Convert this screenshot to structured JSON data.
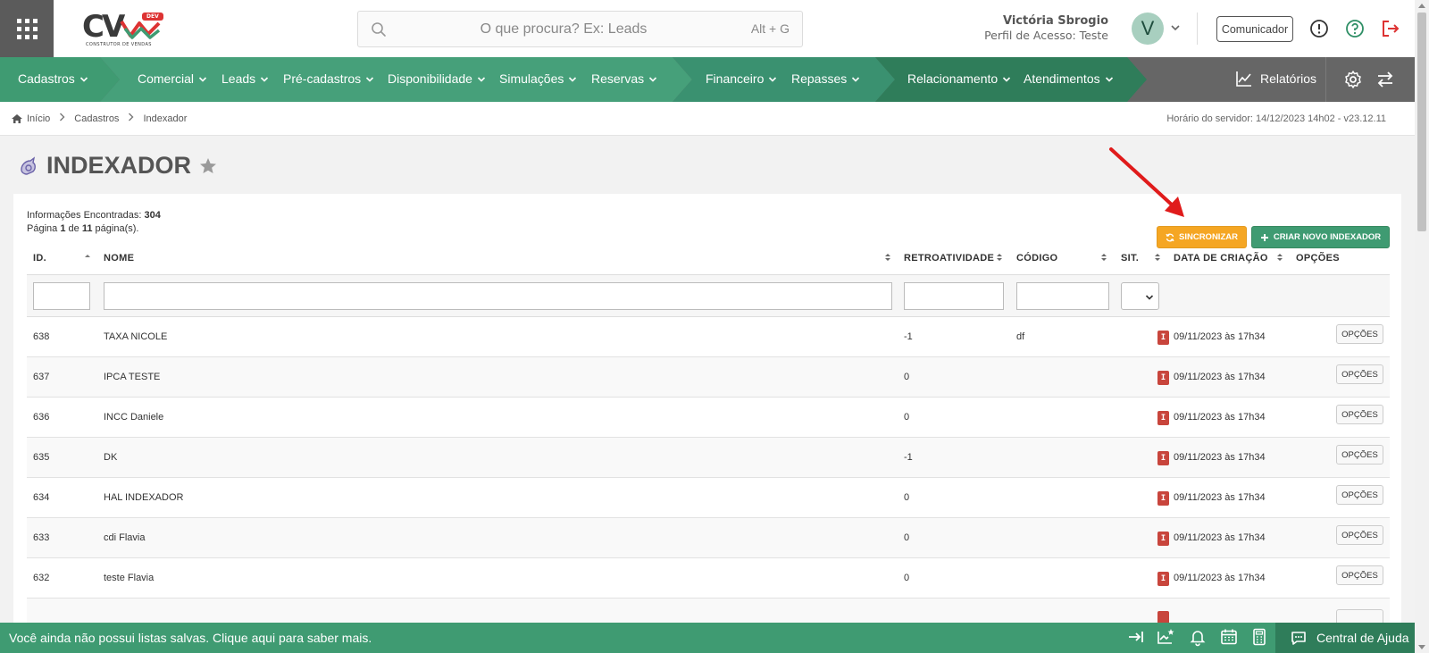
{
  "header": {
    "logo": {
      "text": "CV",
      "badge": "DEV",
      "subtitle": "CONSTRUTOR DE VENDAS"
    },
    "search": {
      "placeholder": "O que procura? Ex: Leads",
      "shortcut": "Alt + G"
    },
    "user": {
      "name": "Victória Sbrogio",
      "profile": "Perfil de Acesso: Teste",
      "initial": "V"
    },
    "communicator_label": "Comunicador"
  },
  "nav": {
    "items": [
      {
        "label": "Cadastros"
      },
      {
        "label": "Comercial"
      },
      {
        "label": "Leads"
      },
      {
        "label": "Pré-cadastros"
      },
      {
        "label": "Disponibilidade"
      },
      {
        "label": "Simulações"
      },
      {
        "label": "Reservas"
      },
      {
        "label": "Financeiro"
      },
      {
        "label": "Repasses"
      },
      {
        "label": "Relacionamento"
      },
      {
        "label": "Atendimentos"
      }
    ],
    "reports_label": "Relatórios",
    "colors": {
      "seg1": "#3f9b72",
      "seg2": "#46a07a",
      "seg3": "#3a9170",
      "seg4": "#2f7d5a",
      "rest": "#666666"
    }
  },
  "breadcrumb": {
    "items": [
      "Início",
      "Cadastros",
      "Indexador"
    ],
    "server_time": "Horário do servidor: 14/12/2023 14h02 - v23.12.11"
  },
  "page": {
    "title": "INDEXADOR"
  },
  "info": {
    "found_label": "Informações Encontradas:",
    "found_count": "304",
    "page_prefix": "Página",
    "page_current": "1",
    "page_of": "de",
    "page_total": "11",
    "page_suffix": "página(s)."
  },
  "actions": {
    "sync_label": "SINCRONIZAR",
    "new_label": "CRIAR NOVO INDEXADOR",
    "sync_color": "#f5a623",
    "new_color": "#3f9b72"
  },
  "table": {
    "columns": [
      "ID.",
      "NOME",
      "RETROATIVIDADE",
      "CÓDIGO",
      "SIT.",
      "DATA DE CRIAÇÃO",
      "OPÇÕES"
    ],
    "status_badge": "I",
    "options_label": "OPÇÕES",
    "rows": [
      {
        "id": "638",
        "name": "TAXA NICOLE",
        "retro": "-1",
        "code": "df",
        "date": "09/11/2023 às 17h34"
      },
      {
        "id": "637",
        "name": "IPCA TESTE",
        "retro": "0",
        "code": "",
        "date": "09/11/2023 às 17h34"
      },
      {
        "id": "636",
        "name": "INCC Daniele",
        "retro": "0",
        "code": "",
        "date": "09/11/2023 às 17h34"
      },
      {
        "id": "635",
        "name": "DK",
        "retro": "-1",
        "code": "",
        "date": "09/11/2023 às 17h34"
      },
      {
        "id": "634",
        "name": "HAL INDEXADOR",
        "retro": "0",
        "code": "",
        "date": "09/11/2023 às 17h34"
      },
      {
        "id": "633",
        "name": "cdi Flavia",
        "retro": "0",
        "code": "",
        "date": "09/11/2023 às 17h34"
      },
      {
        "id": "632",
        "name": "teste Flavia",
        "retro": "0",
        "code": "",
        "date": "09/11/2023 às 17h34"
      }
    ]
  },
  "footer": {
    "message": "Você ainda não possui listas salvas. Clique aqui para saber mais.",
    "help_label": "Central de Ajuda"
  }
}
